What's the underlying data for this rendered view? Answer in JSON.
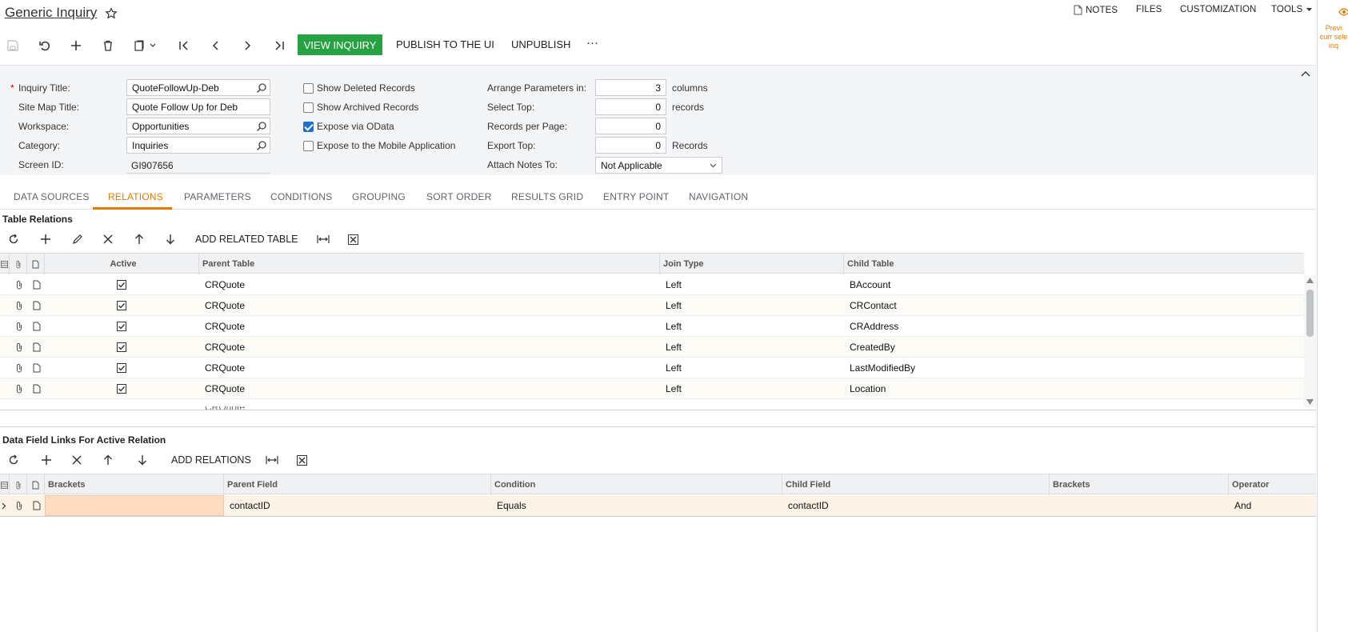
{
  "header": {
    "title": "Generic Inquiry",
    "nav": {
      "notes": "NOTES",
      "files": "FILES",
      "customization": "CUSTOMIZATION",
      "tools": "TOOLS"
    }
  },
  "toolbar": {
    "view_inquiry": "VIEW INQUIRY",
    "publish": "PUBLISH TO THE UI",
    "unpublish": "UNPUBLISH",
    "more": "···"
  },
  "form": {
    "inquiry_title_label": "Inquiry Title:",
    "inquiry_title_required": "*",
    "inquiry_title": "QuoteFollowUp-Deb",
    "site_map_title_label": "Site Map Title:",
    "site_map_title": "Quote Follow Up for Deb",
    "workspace_label": "Workspace:",
    "workspace": "Opportunities",
    "category_label": "Category:",
    "category": "Inquiries",
    "screen_id_label": "Screen ID:",
    "screen_id": "GI907656",
    "show_deleted": "Show Deleted Records",
    "show_archived": "Show Archived Records",
    "expose_odata": "Expose via OData",
    "expose_mobile": "Expose to the Mobile Application",
    "arrange_label": "Arrange Parameters in:",
    "arrange_value": "3",
    "arrange_unit": "columns",
    "select_top_label": "Select Top:",
    "select_top_value": "0",
    "select_top_unit": "records",
    "records_per_page_label": "Records per Page:",
    "records_per_page_value": "0",
    "export_top_label": "Export Top:",
    "export_top_value": "0",
    "export_top_unit": "Records",
    "attach_notes_label": "Attach Notes To:",
    "attach_notes_value": "Not Applicable"
  },
  "tabs": [
    {
      "label": "DATA SOURCES"
    },
    {
      "label": "RELATIONS"
    },
    {
      "label": "PARAMETERS"
    },
    {
      "label": "CONDITIONS"
    },
    {
      "label": "GROUPING"
    },
    {
      "label": "SORT ORDER"
    },
    {
      "label": "RESULTS GRID"
    },
    {
      "label": "ENTRY POINT"
    },
    {
      "label": "NAVIGATION"
    }
  ],
  "relations": {
    "title": "Table Relations",
    "add_button": "ADD RELATED TABLE",
    "columns": {
      "active": "Active",
      "parent": "Parent Table",
      "join": "Join Type",
      "child": "Child Table"
    },
    "rows": [
      {
        "active": true,
        "parent": "CRQuote",
        "join": "Left",
        "child": "BAccount"
      },
      {
        "active": true,
        "parent": "CRQuote",
        "join": "Left",
        "child": "CRContact"
      },
      {
        "active": true,
        "parent": "CRQuote",
        "join": "Left",
        "child": "CRAddress"
      },
      {
        "active": true,
        "parent": "CRQuote",
        "join": "Left",
        "child": "CreatedBy"
      },
      {
        "active": true,
        "parent": "CRQuote",
        "join": "Left",
        "child": "LastModifiedBy"
      },
      {
        "active": true,
        "parent": "CRQuote",
        "join": "Left",
        "child": "Location"
      }
    ]
  },
  "links": {
    "title": "Data Field Links For Active Relation",
    "add_button": "ADD RELATIONS",
    "columns": {
      "brackets_open": "Brackets",
      "parent": "Parent Field",
      "condition": "Condition",
      "child": "Child Field",
      "brackets_close": "Brackets",
      "operator": "Operator"
    },
    "rows": [
      {
        "brackets_open": "",
        "parent": "contactID",
        "condition": "Equals",
        "child": "contactID",
        "brackets_close": "",
        "operator": "And"
      }
    ]
  },
  "side_panel": {
    "text": "Previ curr sele inq"
  },
  "colors": {
    "accent": "#e07b00",
    "primary_button": "#27a243",
    "checkbox": "#1f6fd1"
  }
}
